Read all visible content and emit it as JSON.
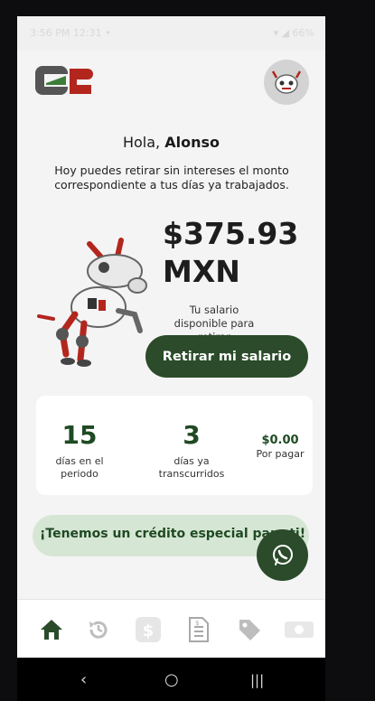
{
  "status_bar": {
    "time": "3:56 PM 12:31 •",
    "icons": "▾ ◢ 66%"
  },
  "header": {
    "logo": "logo-icon",
    "avatar": "robot-avatar-icon"
  },
  "greeting": {
    "prefix": "Hola, ",
    "name": "Alonso"
  },
  "intro_text": "Hoy puedes retirar sin intereses el monto correspondiente a tus días ya trabajados.",
  "salary": {
    "amount": "$375.93",
    "currency": "MXN",
    "caption": "Tu salario disponible para retirar",
    "button_label": "Retirar mi salario"
  },
  "stats": {
    "period_days": "15",
    "period_label": "días en el periodo",
    "worked_days": "3",
    "worked_label": "días ya transcurridos",
    "pending_amount": "$0.00",
    "pending_label": "Por pagar"
  },
  "credit_banner": {
    "text": "¡Tenemos un crédito especial para ti!"
  },
  "bottom_nav": [
    "home-icon",
    "history-icon",
    "dollar-icon",
    "document-icon",
    "tag-icon",
    "cash-icon"
  ],
  "colors": {
    "primary": "#2b4b2a",
    "accent_red": "#b3261e",
    "banner": "#d6e6d4"
  }
}
